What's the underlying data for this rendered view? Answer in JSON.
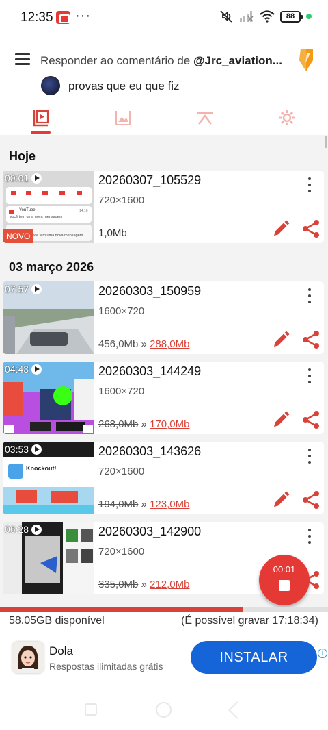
{
  "status_bar": {
    "time": "12:35",
    "dots": "···",
    "battery": "88"
  },
  "reply_header": {
    "title_prefix": "Responder ao comentário de ",
    "title_user": "@Jrc_aviation...",
    "comment_text": "provas que eu que fiz"
  },
  "tabs": [
    {
      "name": "videos",
      "icon": "video-file-icon",
      "active": true
    },
    {
      "name": "images",
      "icon": "image-icon",
      "active": false
    },
    {
      "name": "tools",
      "icon": "tools-icon",
      "active": false
    },
    {
      "name": "settings",
      "icon": "gear-icon",
      "active": false
    }
  ],
  "sections": [
    {
      "title": "Hoje"
    },
    {
      "title": "03 março 2026"
    }
  ],
  "videos": [
    {
      "duration": "00:01",
      "name": "20260307_105529",
      "resolution": "720×1600",
      "size": "1,0Mb",
      "badge": "NOVO"
    },
    {
      "duration": "07:57",
      "name": "20260303_150959",
      "resolution": "1600×720",
      "size_old": "456,0Mb",
      "size_new": "288,0Mb"
    },
    {
      "duration": "04:43",
      "name": "20260303_144249",
      "resolution": "1600×720",
      "size_old": "268,0Mb",
      "size_new": "170,0Mb"
    },
    {
      "duration": "03:53",
      "name": "20260303_143626",
      "resolution": "720×1600",
      "size_old": "194,0Mb",
      "size_new": "123,0Mb"
    },
    {
      "duration": "06:28",
      "name": "20260303_142900",
      "resolution": "720×1600",
      "size_old": "335,0Mb",
      "size_new": "212,0Mb"
    }
  ],
  "size_arrow": "»",
  "thumb_text": {
    "t1_notif_app": "YouTube",
    "t1_notif_msg": "Você tem uma nova mensagem",
    "t1_notif_time": "14:10",
    "t1_notif2_msg": "Você tem uma nova mensagem",
    "t4_title": "Knockout!"
  },
  "record": {
    "elapsed": "00:01"
  },
  "storage": {
    "available": "58.05GB disponível",
    "record_time": "(É possível gravar 17:18:34)",
    "used_fraction": 0.74
  },
  "ad": {
    "app_name": "Dola",
    "description": "Respostas ilimitadas grátis",
    "button_label": "INSTALAR",
    "info": "i"
  },
  "colors": {
    "accent": "#e53935",
    "ad_button": "#1565d8",
    "new_size": "#d84339"
  }
}
